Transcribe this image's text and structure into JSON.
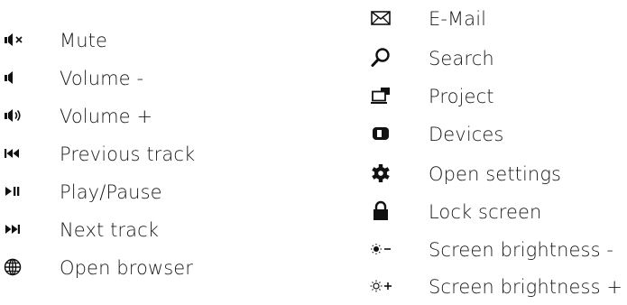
{
  "legend": {
    "left_items": [
      {
        "label": "Mute",
        "icon": "volume-mute-icon"
      },
      {
        "label": "Volume -",
        "icon": "volume-down-icon"
      },
      {
        "label": "Volume +",
        "icon": "volume-up-icon"
      },
      {
        "label": "Previous track",
        "icon": "previous-track-icon"
      },
      {
        "label": "Play/Pause",
        "icon": "play-pause-icon"
      },
      {
        "label": "Next track",
        "icon": "next-track-icon"
      },
      {
        "label": "Open browser",
        "icon": "globe-icon"
      }
    ],
    "right_items": [
      {
        "label": "E-Mail",
        "icon": "envelope-icon"
      },
      {
        "label": "Search",
        "icon": "magnifier-icon"
      },
      {
        "label": "Project",
        "icon": "project-display-icon"
      },
      {
        "label": "Devices",
        "icon": "devices-icon"
      },
      {
        "label": "Open settings",
        "icon": "gear-icon"
      },
      {
        "label": "Lock screen",
        "icon": "lock-icon"
      },
      {
        "label": "Screen brightness -",
        "icon": "brightness-down-icon"
      },
      {
        "label": "Screen brightness +",
        "icon": "brightness-up-icon"
      }
    ]
  },
  "colors": {
    "text": "#1a1a1a",
    "icon": "#111111",
    "background": "#ffffff"
  }
}
